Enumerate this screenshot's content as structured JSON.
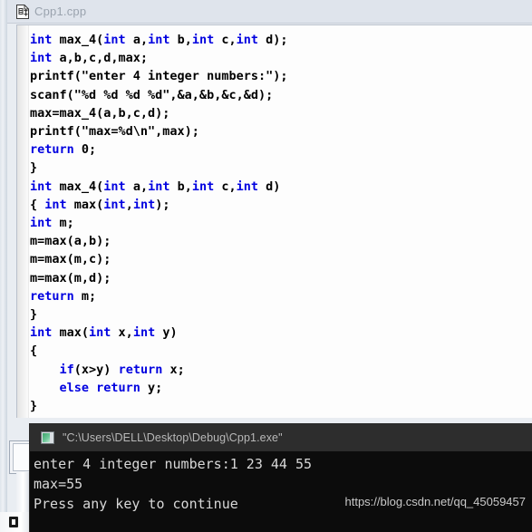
{
  "tab": {
    "label": "Cpp1.cpp",
    "icon": "cpp-file-icon"
  },
  "editor": {
    "lines": [
      [
        {
          "t": "int",
          "c": "kw"
        },
        {
          "t": " max_4(",
          "c": "pl"
        },
        {
          "t": "int",
          "c": "kw"
        },
        {
          "t": " a,",
          "c": "pl"
        },
        {
          "t": "int",
          "c": "kw"
        },
        {
          "t": " b,",
          "c": "pl"
        },
        {
          "t": "int",
          "c": "kw"
        },
        {
          "t": " c,",
          "c": "pl"
        },
        {
          "t": "int",
          "c": "kw"
        },
        {
          "t": " d);",
          "c": "pl"
        }
      ],
      [
        {
          "t": "int",
          "c": "kw"
        },
        {
          "t": " a,b,c,d,max;",
          "c": "pl"
        }
      ],
      [
        {
          "t": "printf(\"enter 4 integer numbers:\");",
          "c": "pl"
        }
      ],
      [
        {
          "t": "scanf(\"%d %d %d %d\",&a,&b,&c,&d);",
          "c": "pl"
        }
      ],
      [
        {
          "t": "max=max_4(a,b,c,d);",
          "c": "pl"
        }
      ],
      [
        {
          "t": "printf(\"max=%d\\n\",max);",
          "c": "pl"
        }
      ],
      [
        {
          "t": "return",
          "c": "kw"
        },
        {
          "t": " 0;",
          "c": "pl"
        }
      ],
      [
        {
          "t": "}",
          "c": "pl"
        }
      ],
      [
        {
          "t": "int",
          "c": "kw"
        },
        {
          "t": " max_4(",
          "c": "pl"
        },
        {
          "t": "int",
          "c": "kw"
        },
        {
          "t": " a,",
          "c": "pl"
        },
        {
          "t": "int",
          "c": "kw"
        },
        {
          "t": " b,",
          "c": "pl"
        },
        {
          "t": "int",
          "c": "kw"
        },
        {
          "t": " c,",
          "c": "pl"
        },
        {
          "t": "int",
          "c": "kw"
        },
        {
          "t": " d)",
          "c": "pl"
        }
      ],
      [
        {
          "t": "{ ",
          "c": "pl"
        },
        {
          "t": "int",
          "c": "kw"
        },
        {
          "t": " max(",
          "c": "pl"
        },
        {
          "t": "int",
          "c": "kw"
        },
        {
          "t": ",",
          "c": "pl"
        },
        {
          "t": "int",
          "c": "kw"
        },
        {
          "t": ");",
          "c": "pl"
        }
      ],
      [
        {
          "t": "int",
          "c": "kw"
        },
        {
          "t": " m;",
          "c": "pl"
        }
      ],
      [
        {
          "t": "m=max(a,b);",
          "c": "pl"
        }
      ],
      [
        {
          "t": "m=max(m,c);",
          "c": "pl"
        }
      ],
      [
        {
          "t": "m=max(m,d);",
          "c": "pl"
        }
      ],
      [
        {
          "t": "return",
          "c": "kw"
        },
        {
          "t": " m;",
          "c": "pl"
        }
      ],
      [
        {
          "t": "}",
          "c": "pl"
        }
      ],
      [
        {
          "t": "int",
          "c": "kw"
        },
        {
          "t": " max(",
          "c": "pl"
        },
        {
          "t": "int",
          "c": "kw"
        },
        {
          "t": " x,",
          "c": "pl"
        },
        {
          "t": "int",
          "c": "kw"
        },
        {
          "t": " y)",
          "c": "pl"
        }
      ],
      [
        {
          "t": "{",
          "c": "pl"
        }
      ],
      [
        {
          "t": "    ",
          "c": "pl"
        },
        {
          "t": "if",
          "c": "kw"
        },
        {
          "t": "(x>y) ",
          "c": "pl"
        },
        {
          "t": "return",
          "c": "kw"
        },
        {
          "t": " x;",
          "c": "pl"
        }
      ],
      [
        {
          "t": "    ",
          "c": "pl"
        },
        {
          "t": "else return",
          "c": "kw"
        },
        {
          "t": " y;",
          "c": "pl"
        }
      ],
      [
        {
          "t": "}",
          "c": "pl"
        }
      ]
    ]
  },
  "console": {
    "title": "\"C:\\Users\\DELL\\Desktop\\Debug\\Cpp1.exe\"",
    "icon": "console-window-icon",
    "lines": [
      "enter 4 integer numbers:1 23 44 55",
      "max=55",
      "Press any key to continue"
    ]
  },
  "watermark": {
    "text": "https://blog.csdn.net/qq_45059457"
  },
  "colors": {
    "keyword": "#0000e0",
    "code_text": "#000000",
    "editor_bg": "#fdfdfd",
    "tab_bg": "#dfe4ec",
    "console_bg": "#0c0c0c",
    "console_title_bg": "#2d2d2d",
    "console_text": "#d8d8d8"
  }
}
